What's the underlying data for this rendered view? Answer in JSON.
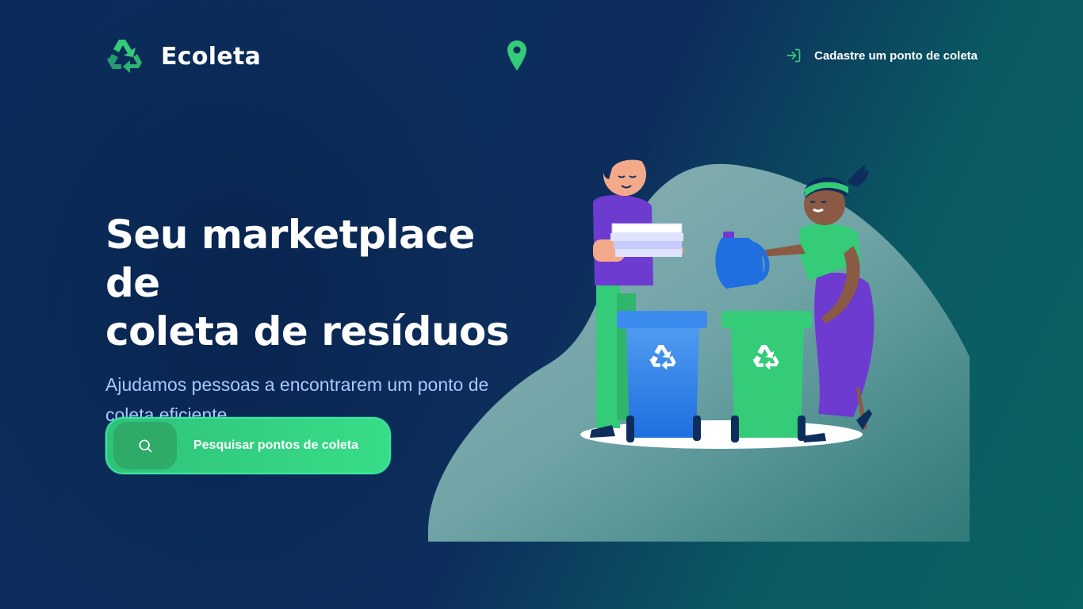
{
  "header": {
    "logo_text": "Ecoleta",
    "logo_icon": "recycle-icon",
    "location_icon": "map-pin-icon",
    "register_link": {
      "icon": "log-in-icon",
      "label": "Cadastre um ponto de coleta"
    }
  },
  "hero": {
    "title_line1": "Seu marketplace de",
    "title_line2": "coleta de resíduos",
    "subtitle": "Ajudamos pessoas a encontrarem um ponto de coleta eficiente"
  },
  "search_button": {
    "icon": "search-icon",
    "label": "Pesquisar pontos de coleta"
  },
  "illustration": {
    "description_icon": "recycling-people-illustration"
  },
  "colors": {
    "background_dark": "#0d2e5c",
    "background_teal": "#0a6360",
    "accent_green": "#34cb79",
    "subtitle_blue": "#a9c8ff"
  }
}
